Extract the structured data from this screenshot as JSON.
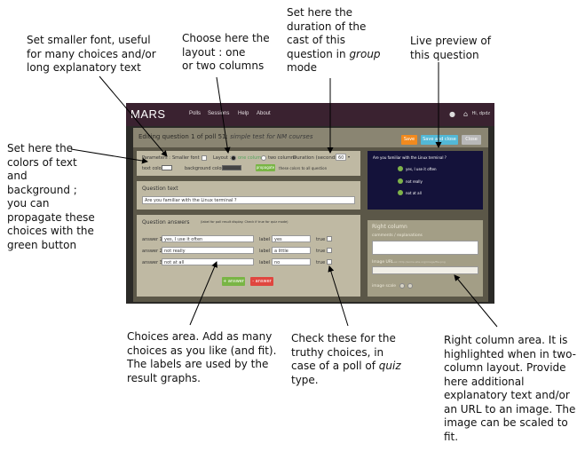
{
  "app": {
    "logo": "MARS",
    "nav": [
      "Polls",
      "Sessions",
      "Help",
      "About"
    ],
    "user_greeting": "Hi, dpdz"
  },
  "editor": {
    "title_prefix": "Editing question 1 of poll 51:",
    "title_poll": "simple test for NM courses",
    "buttons": {
      "save": "Save",
      "save_close": "Save and close",
      "close": "Close"
    },
    "parameters_label": "Parameters :",
    "smaller_font_label": "Smaller font",
    "layout_label": "Layout :",
    "layout_one": "one column",
    "layout_two": "two columns",
    "duration_label": "Duration (seconds):",
    "duration_value": "60",
    "text_color_label": "text color",
    "background_color_label": "background color",
    "propagate_button": "propagate",
    "propagate_note": "these colors to all question",
    "question_text_header": "Question text",
    "question_text_value": "Are you familiar with the Linux terminal ?",
    "answers_header": "Question answers",
    "answers_note": "(label for poll result display. Check if true for quiz mode)",
    "label_word": "label",
    "true_word": "true",
    "answers": [
      {
        "name": "answer 1 :",
        "value": "yes, I use it often",
        "label": "yes"
      },
      {
        "name": "answer 2 :",
        "value": "not really",
        "label": "a little"
      },
      {
        "name": "answer 3 :",
        "value": "not at all",
        "label": "no"
      }
    ],
    "add_answer": "+ answer",
    "remove_answer": "- answer",
    "right_column_header": "Right column",
    "right_comments_label": "comments / explanations",
    "image_url_label": "Image URL",
    "image_url_placeholder": "ex: http://some.site.org/image/file.png",
    "image_scale_label": "image scale"
  },
  "preview": {
    "question": "Are you familiar with the Linux terminal ?",
    "answers": [
      "yes, I use it often",
      "not really",
      "not at all"
    ]
  },
  "annotations": {
    "font": [
      "Set smaller font, useful",
      "for many choices and/or",
      "long explanatory text"
    ],
    "layout": [
      "Choose here the",
      "layout : one",
      "or two columns"
    ],
    "duration": [
      "Set here the",
      "duration of the",
      "cast of this",
      "question in",
      "group",
      "mode"
    ],
    "preview": [
      "Live preview of",
      "this question"
    ],
    "colors": [
      "Set here the",
      "colors of text",
      "and",
      "background ;",
      "you can",
      "propagate these",
      "choices with the",
      "green button"
    ],
    "choices": [
      "Choices area. Add as many",
      "choices as you like (and fit).",
      "The labels are used by the",
      "result graphs."
    ],
    "truthy_1": "Check these for the",
    "truthy_2": "truthy choices, in",
    "truthy_3": "case of a poll of",
    "truthy_quiz": "quiz",
    "truthy_4": "type.",
    "right_col": [
      "Right column area. It is",
      "highlighted when in two-",
      "column layout. Provide",
      "here additional",
      "explanatory text and/or",
      "an URL to an image. The",
      "image can be scaled to",
      "fit."
    ]
  },
  "colors": {
    "topbar": "#3a2230",
    "save": "#f28a1e",
    "save_close": "#53b8d6",
    "close": "#b8b8b8",
    "add_answer": "#79b545",
    "remove_answer": "#e0463f",
    "preview_bg": "#14123a",
    "preview_dot": "#7fb34a"
  }
}
